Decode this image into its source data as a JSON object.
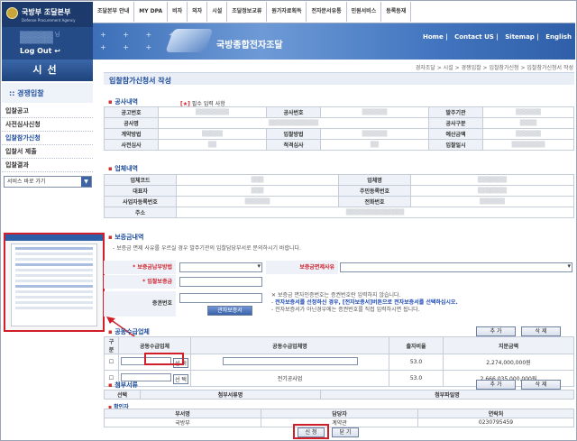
{
  "brand": {
    "title": "국방부 조달본부",
    "subtitle": "Defense Procurement Agency"
  },
  "user": {
    "logout_label": "Log Out"
  },
  "sidebar": {
    "title": "시선",
    "section": ":: 경쟁입찰",
    "items": [
      {
        "label": "입찰공고"
      },
      {
        "label": "사전심사신청"
      },
      {
        "label": "입찰참가신청"
      },
      {
        "label": "입찰서 제출"
      },
      {
        "label": "입찰결과"
      }
    ],
    "quick_select": "서비스 바로 가기"
  },
  "topnav": {
    "items": [
      "조달본부 안내",
      "MY DPA",
      "비자",
      "외자",
      "시설",
      "조달정보교류",
      "원가자료획득",
      "전자문서유통",
      "민원서비스",
      "등록등재"
    ]
  },
  "banner": {
    "title": "국방종합전자조달",
    "links": [
      "Home",
      "Contact US",
      "Sitemap",
      "English"
    ]
  },
  "breadcrumb": "경자조달 > 시설 > 경쟁입찰 > 입찰참가신청 > 입찰참가신청서 작성",
  "page_title": "입찰참가신청서 작성",
  "notice": {
    "mark": "[★]",
    "text": "필수 입력 사항"
  },
  "sections": {
    "contract": "공사내역",
    "company": "업체내역",
    "guarantee": "보증금내역",
    "attach": "첨부서류"
  },
  "contract_table": {
    "rows": [
      [
        "공고번호",
        "공사번호",
        "발주기관"
      ],
      [
        "공사명",
        "공사구분"
      ],
      [
        "계약방법",
        "입찰방법",
        "예산금액"
      ],
      [
        "사전심사",
        "적격심사",
        "입찰일시"
      ]
    ]
  },
  "company_table": {
    "rows": [
      [
        "업체코드",
        "업체명"
      ],
      [
        "대표자",
        "주민등록번호"
      ],
      [
        "사업자등록번호",
        "전화번호"
      ],
      [
        "주소"
      ]
    ]
  },
  "guarantee": {
    "help_text": "- 보증금 면제 사유를 우르실 경우 발주기관의 입찰담당부서로 문의하시기 바랍니다.",
    "method_label": "보증금납부방법",
    "reason_label": "보증금면제사유",
    "amount_label": "입찰보증금",
    "cert_label": "증권번호",
    "cert_button": "관자보증서",
    "note1": "보증금 면자인증번호는 증권번호란 입력하지 않습니다.",
    "note2": "전자보증서를 선정하신 경우, [전자보증서]버튼으로 전자보증서를 선택하십시오.",
    "note3": "- 전자보증서가 아닌경우에는 증권번호를 직접 입력하시면 됩니다."
  },
  "subcontract": {
    "title": "공동수급업체",
    "add_button": "추 가",
    "delete_button": "삭 제",
    "columns": [
      "구분",
      "공동수급업체",
      "공동수급업체명",
      "출자비율",
      "지분금액"
    ],
    "rows": [
      {
        "select_button": "선 택",
        "rate": "53.0",
        "amount": "2,274,000,000원"
      },
      {
        "select_button": "선 택",
        "type": "전기공사업",
        "rate": "53.0",
        "amount": "2,666,035,000,000원"
      }
    ]
  },
  "attachments": {
    "title": "첨부서류",
    "add_button": "추 가",
    "delete_button": "삭 제",
    "columns": [
      "선택",
      "첨부서류명",
      "첨부파일명"
    ]
  },
  "signer": {
    "title": "확인자",
    "columns": [
      "부서명",
      "담당자",
      "연락처"
    ],
    "values": [
      "국방부",
      "계약관",
      "0230795459"
    ]
  },
  "actions": {
    "submit_label": "신 청",
    "close_label": "닫 기"
  }
}
